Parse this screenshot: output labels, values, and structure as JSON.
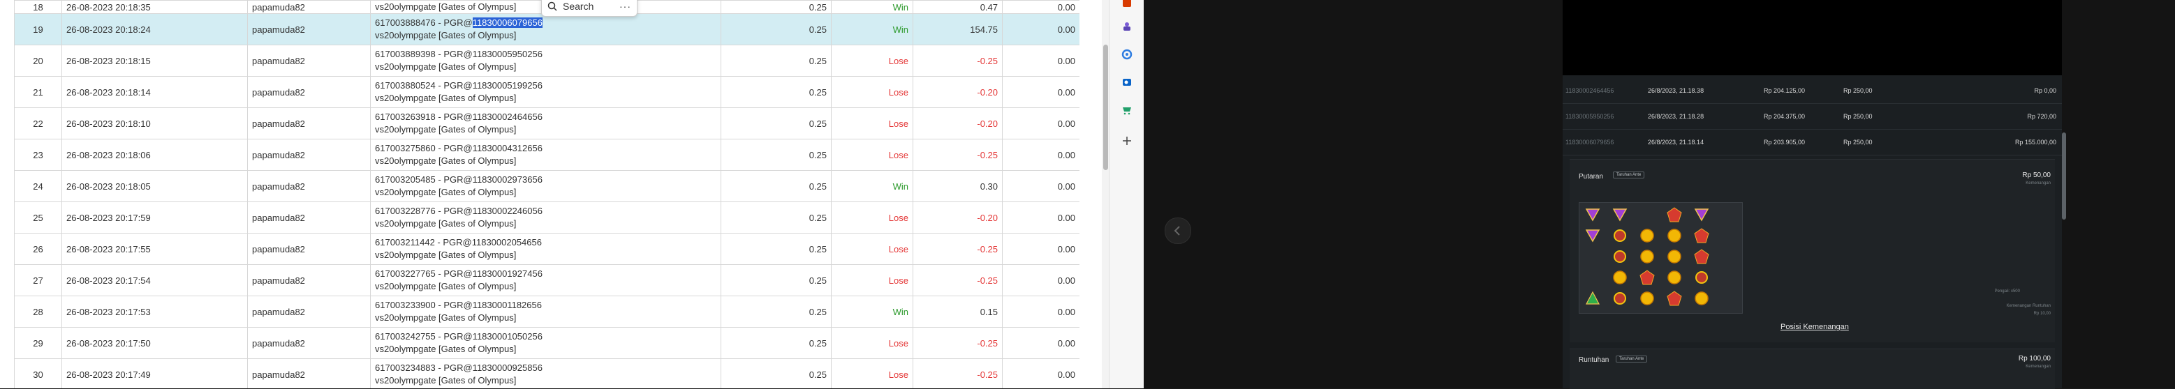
{
  "table": {
    "rows": [
      {
        "no": "18",
        "date": "26-08-2023 20:18:35",
        "user": "papamuda82",
        "tx_line1": "",
        "tx_line2": "vs20olympgate [Gates of Olympus]",
        "bet": "0.25",
        "result": "Win",
        "profit": "0.47",
        "balance": "0.00"
      },
      {
        "no": "19",
        "date": "26-08-2023 20:18:24",
        "user": "papamuda82",
        "tx_line1": "617003888476 - PGR@",
        "tx_highlight": "11830006079656",
        "tx_line2": "vs20olympgate [Gates of Olympus]",
        "bet": "0.25",
        "result": "Win",
        "profit": "154.75",
        "balance": "0.00"
      },
      {
        "no": "20",
        "date": "26-08-2023 20:18:15",
        "user": "papamuda82",
        "tx_line1": "617003889398 - PGR@11830005950256",
        "tx_line2": "vs20olympgate [Gates of Olympus]",
        "bet": "0.25",
        "result": "Lose",
        "profit": "-0.25",
        "balance": "0.00"
      },
      {
        "no": "21",
        "date": "26-08-2023 20:18:14",
        "user": "papamuda82",
        "tx_line1": "617003880524 - PGR@11830005199256",
        "tx_line2": "vs20olympgate [Gates of Olympus]",
        "bet": "0.25",
        "result": "Lose",
        "profit": "-0.20",
        "balance": "0.00"
      },
      {
        "no": "22",
        "date": "26-08-2023 20:18:10",
        "user": "papamuda82",
        "tx_line1": "617003263918 - PGR@11830002464656",
        "tx_line2": "vs20olympgate [Gates of Olympus]",
        "bet": "0.25",
        "result": "Lose",
        "profit": "-0.20",
        "balance": "0.00"
      },
      {
        "no": "23",
        "date": "26-08-2023 20:18:06",
        "user": "papamuda82",
        "tx_line1": "617003275860 - PGR@11830004312656",
        "tx_line2": "vs20olympgate [Gates of Olympus]",
        "bet": "0.25",
        "result": "Lose",
        "profit": "-0.25",
        "balance": "0.00"
      },
      {
        "no": "24",
        "date": "26-08-2023 20:18:05",
        "user": "papamuda82",
        "tx_line1": "617003205485 - PGR@11830002973656",
        "tx_line2": "vs20olympgate [Gates of Olympus]",
        "bet": "0.25",
        "result": "Win",
        "profit": "0.30",
        "balance": "0.00"
      },
      {
        "no": "25",
        "date": "26-08-2023 20:17:59",
        "user": "papamuda82",
        "tx_line1": "617003228776 - PGR@11830002246056",
        "tx_line2": "vs20olympgate [Gates of Olympus]",
        "bet": "0.25",
        "result": "Lose",
        "profit": "-0.20",
        "balance": "0.00"
      },
      {
        "no": "26",
        "date": "26-08-2023 20:17:55",
        "user": "papamuda82",
        "tx_line1": "617003211442 - PGR@11830002054656",
        "tx_line2": "vs20olympgate [Gates of Olympus]",
        "bet": "0.25",
        "result": "Lose",
        "profit": "-0.25",
        "balance": "0.00"
      },
      {
        "no": "27",
        "date": "26-08-2023 20:17:54",
        "user": "papamuda82",
        "tx_line1": "617003227765 - PGR@11830001927456",
        "tx_line2": "vs20olympgate [Gates of Olympus]",
        "bet": "0.25",
        "result": "Lose",
        "profit": "-0.25",
        "balance": "0.00"
      },
      {
        "no": "28",
        "date": "26-08-2023 20:17:53",
        "user": "papamuda82",
        "tx_line1": "617003233900 - PGR@11830001182656",
        "tx_line2": "vs20olympgate [Gates of Olympus]",
        "bet": "0.25",
        "result": "Win",
        "profit": "0.15",
        "balance": "0.00"
      },
      {
        "no": "29",
        "date": "26-08-2023 20:17:50",
        "user": "papamuda82",
        "tx_line1": "617003242755 - PGR@11830001050256",
        "tx_line2": "vs20olympgate [Gates of Olympus]",
        "bet": "0.25",
        "result": "Lose",
        "profit": "-0.25",
        "balance": "0.00"
      },
      {
        "no": "30",
        "date": "26-08-2023 20:17:49",
        "user": "papamuda82",
        "tx_line1": "617003234883 - PGR@11830000925856",
        "tx_line2": "vs20olympgate [Gates of Olympus]",
        "bet": "0.25",
        "result": "Lose",
        "profit": "-0.25",
        "balance": "0.00"
      }
    ]
  },
  "search_popup": {
    "label": "Search",
    "more": "···"
  },
  "sidebar_icons": [
    "office-icon",
    "teams-icon",
    "copilot-icon",
    "outlook-icon",
    "shopping-icon",
    "add-icon"
  ],
  "panel": {
    "tx_rows": [
      {
        "id": "11830002464456",
        "date": "26/8/2023, 21.18.38",
        "balance": "Rp 204.125,00",
        "bet": "Rp 250,00",
        "win": "Rp 0,00"
      },
      {
        "id": "11830005950256",
        "date": "26/8/2023, 21.18.28",
        "balance": "Rp 204.375,00",
        "bet": "Rp 250,00",
        "win": "Rp 720,00"
      },
      {
        "id": "11830006079656",
        "date": "26/8/2023, 21.18.14",
        "balance": "Rp 203.905,00",
        "bet": "Rp 250,00",
        "win": "Rp 155.000,00"
      }
    ],
    "putaran": {
      "title": "Putaran",
      "tag": "Taruhan Ante",
      "amount": "Rp 50,00",
      "amount_sub": "Kemenangan",
      "right_note1": "Pengali: x500",
      "right_note2": "Kemenangan Runtuhan",
      "right_note3": "Rp 10,00"
    },
    "link": "Posisi Kemenangan",
    "runtuhan": {
      "title": "Runtuhan",
      "tag": "Taruhan Ante",
      "amount": "Rp 100,00",
      "amount_sub": "Kemenangan"
    }
  },
  "colors": {
    "win": "#2e9b2e",
    "lose": "#e43535",
    "selected_row": "#d3edf3",
    "highlight": "#2a62d6"
  }
}
